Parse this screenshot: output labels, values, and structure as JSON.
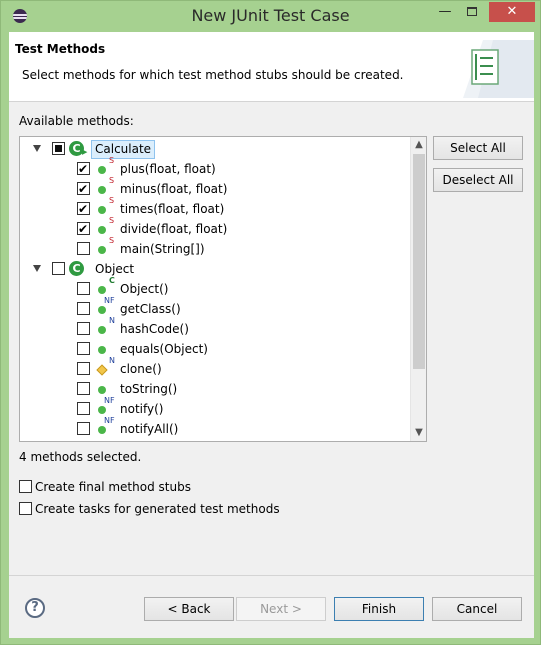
{
  "window": {
    "title": "New JUnit Test Case"
  },
  "header": {
    "title": "Test Methods",
    "description": "Select methods for which test method stubs should be created."
  },
  "available_label": "Available methods:",
  "tree": {
    "classes": [
      {
        "name": "Calculate",
        "state": "partial",
        "selected": true,
        "methods": [
          {
            "label": "plus(float, float)",
            "checked": true,
            "modifier": "S",
            "visibility": "public"
          },
          {
            "label": "minus(float, float)",
            "checked": true,
            "modifier": "S",
            "visibility": "public"
          },
          {
            "label": "times(float, float)",
            "checked": true,
            "modifier": "S",
            "visibility": "public"
          },
          {
            "label": "divide(float, float)",
            "checked": true,
            "modifier": "S",
            "visibility": "public"
          },
          {
            "label": "main(String[])",
            "checked": false,
            "modifier": "S",
            "visibility": "public"
          }
        ]
      },
      {
        "name": "Object",
        "state": "unchecked",
        "selected": false,
        "methods": [
          {
            "label": "Object()",
            "checked": false,
            "modifier": "C",
            "visibility": "public"
          },
          {
            "label": "getClass()",
            "checked": false,
            "modifier": "NF",
            "visibility": "public"
          },
          {
            "label": "hashCode()",
            "checked": false,
            "modifier": "N",
            "visibility": "public"
          },
          {
            "label": "equals(Object)",
            "checked": false,
            "modifier": "",
            "visibility": "public"
          },
          {
            "label": "clone()",
            "checked": false,
            "modifier": "N",
            "visibility": "protected"
          },
          {
            "label": "toString()",
            "checked": false,
            "modifier": "",
            "visibility": "public"
          },
          {
            "label": "notify()",
            "checked": false,
            "modifier": "NF",
            "visibility": "public"
          },
          {
            "label": "notifyAll()",
            "checked": false,
            "modifier": "NF",
            "visibility": "public"
          }
        ]
      }
    ]
  },
  "buttons": {
    "select_all": "Select All",
    "deselect_all": "Deselect All",
    "back": "< Back",
    "next": "Next >",
    "finish": "Finish",
    "cancel": "Cancel",
    "help": "?"
  },
  "status": {
    "selected_count": "4 methods selected."
  },
  "options": {
    "final_stubs": {
      "label": "Create final method stubs",
      "checked": false
    },
    "create_tasks": {
      "label": "Create tasks for generated test methods",
      "checked": false
    }
  },
  "colors": {
    "window_frame": "#a6d190",
    "close_button": "#c7504b",
    "public_method": "#4bb649",
    "class_icon": "#2f9a41",
    "static_modifier": "#c0202a"
  }
}
